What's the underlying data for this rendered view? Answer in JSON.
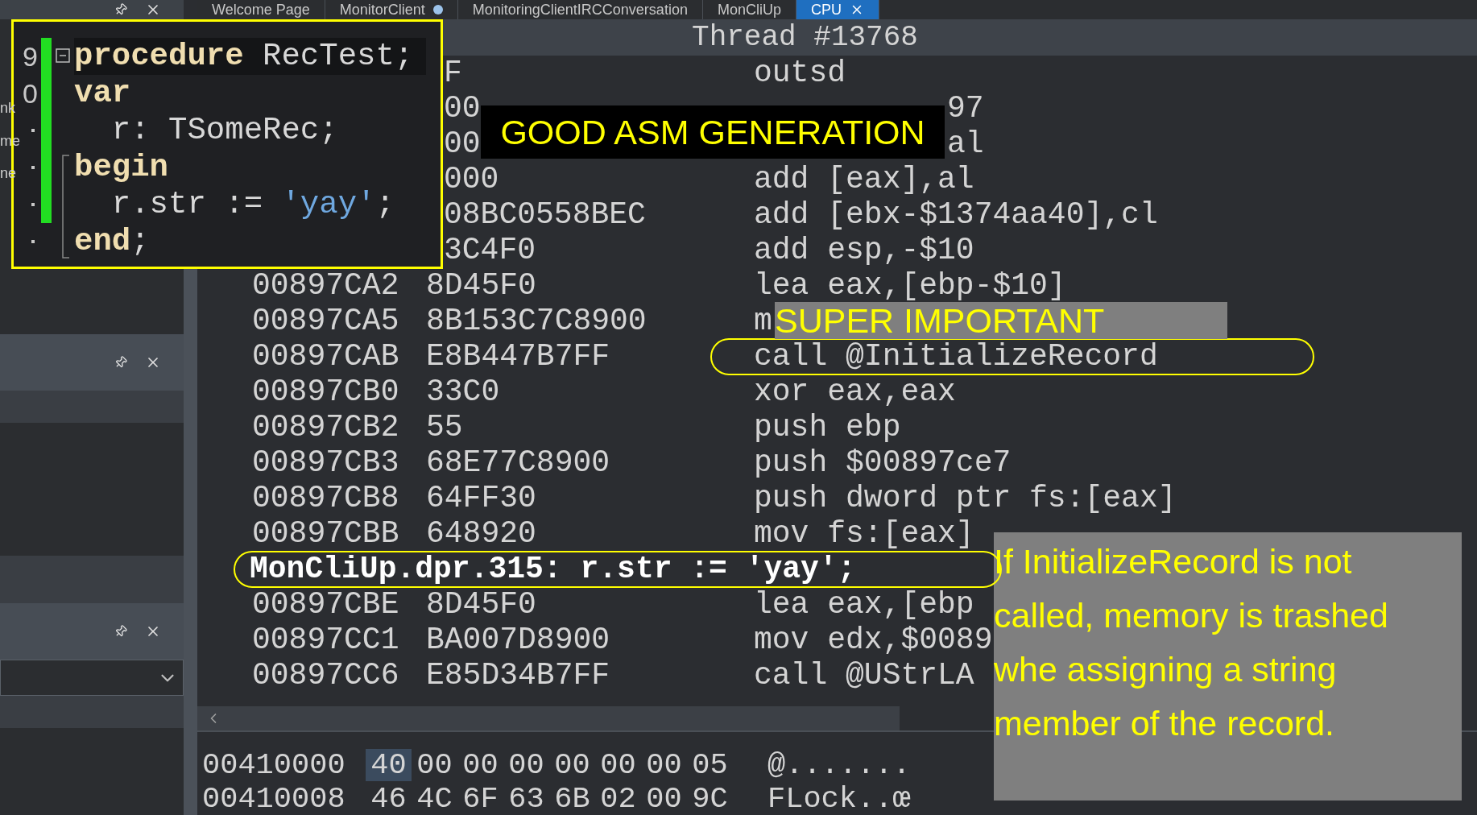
{
  "left_dock": {
    "fragments": [
      "nk",
      "me",
      "ne"
    ]
  },
  "tabs": [
    {
      "label": "Welcome Page",
      "selected": false,
      "modified": false
    },
    {
      "label": "MonitorClient",
      "selected": false,
      "modified": true
    },
    {
      "label": "MonitoringClientIRCConversation",
      "selected": false,
      "modified": false
    },
    {
      "label": "MonCliUp",
      "selected": false,
      "modified": false
    },
    {
      "label": "CPU",
      "selected": true,
      "modified": false
    }
  ],
  "disassembly": {
    "title": "Thread #13768",
    "rows": [
      {
        "kind": "covered",
        "bytes": "F",
        "instruction": "outsd",
        "circled": false
      },
      {
        "kind": "covered-tail",
        "bytes": "00",
        "instruction": "97",
        "circled": false
      },
      {
        "kind": "covered-tail",
        "bytes": "00",
        "instruction": "al",
        "circled": false
      },
      {
        "kind": "covered",
        "bytes": "000",
        "instruction": "add [eax],al",
        "circled": false
      },
      {
        "kind": "covered",
        "bytes": "08BC0558BEC",
        "instruction": "add [ebx-$1374aa40],cl",
        "circled": false
      },
      {
        "kind": "covered",
        "bytes": "3C4F0",
        "instruction": "add esp,-$10",
        "circled": false
      },
      {
        "kind": "line",
        "address": "00897CA2",
        "bytes": "8D45F0",
        "instruction": "lea eax,[ebp-$10]",
        "circled": false
      },
      {
        "kind": "line",
        "address": "00897CA5",
        "bytes": "8B153C7C8900",
        "instruction": "m",
        "circled": false
      },
      {
        "kind": "line",
        "address": "00897CAB",
        "bytes": "E8B447B7FF",
        "instruction": "call @InitializeRecord",
        "circled": true
      },
      {
        "kind": "line",
        "address": "00897CB0",
        "bytes": "33C0",
        "instruction": "xor eax,eax",
        "circled": false
      },
      {
        "kind": "line",
        "address": "00897CB2",
        "bytes": "55",
        "instruction": "push ebp",
        "circled": false
      },
      {
        "kind": "line",
        "address": "00897CB3",
        "bytes": "68E77C8900",
        "instruction": "push $00897ce7",
        "circled": false
      },
      {
        "kind": "line",
        "address": "00897CB8",
        "bytes": "64FF30",
        "instruction": "push dword ptr fs:[eax]",
        "circled": false
      },
      {
        "kind": "line",
        "address": "00897CBB",
        "bytes": "648920",
        "instruction": "mov fs:[eax]",
        "circled": false
      },
      {
        "kind": "source",
        "text": "MonCliUp.dpr.315: r.str := 'yay';",
        "circled": true
      },
      {
        "kind": "line",
        "address": "00897CBE",
        "bytes": "8D45F0",
        "instruction": "lea eax,[ebp",
        "circled": false
      },
      {
        "kind": "line",
        "address": "00897CC1",
        "bytes": "BA007D8900",
        "instruction": "mov edx,$0089",
        "circled": false
      },
      {
        "kind": "line",
        "address": "00897CC6",
        "bytes": "E85D34B7FF",
        "instruction": "call @UStrLA",
        "circled": false
      }
    ]
  },
  "hex_view": {
    "rows": [
      {
        "address": "00410000",
        "bytes": [
          {
            "value": "40",
            "selected": true
          },
          {
            "value": "00",
            "selected": false
          },
          {
            "value": "00",
            "selected": false
          },
          {
            "value": "00",
            "selected": false
          },
          {
            "value": "00",
            "selected": false
          },
          {
            "value": "00",
            "selected": false
          },
          {
            "value": "00",
            "selected": false
          },
          {
            "value": "05",
            "selected": false
          }
        ],
        "ascii": "@......."
      },
      {
        "address": "00410008",
        "bytes": [
          {
            "value": "46",
            "selected": false
          },
          {
            "value": "4C",
            "selected": false
          },
          {
            "value": "6F",
            "selected": false
          },
          {
            "value": "63",
            "selected": false
          },
          {
            "value": "6B",
            "selected": false
          },
          {
            "value": "02",
            "selected": false
          },
          {
            "value": "00",
            "selected": false
          },
          {
            "value": "9C",
            "selected": false
          }
        ],
        "ascii": "FLock..œ"
      }
    ]
  },
  "code_snippet": {
    "line_numbers": [
      "9",
      "0"
    ],
    "lines": [
      {
        "current": true,
        "tokens": [
          {
            "kind": "keyword",
            "text": "procedure"
          },
          {
            "kind": "plain",
            "text": " RecTest;"
          }
        ]
      },
      {
        "current": false,
        "tokens": [
          {
            "kind": "keyword",
            "text": "var"
          }
        ]
      },
      {
        "current": false,
        "tokens": [
          {
            "kind": "plain",
            "text": "  r: TSomeRec;"
          }
        ]
      },
      {
        "current": false,
        "tokens": [
          {
            "kind": "keyword",
            "text": "begin"
          }
        ]
      },
      {
        "current": false,
        "tokens": [
          {
            "kind": "plain",
            "text": "  r.str := "
          },
          {
            "kind": "string",
            "text": "'yay'"
          },
          {
            "kind": "plain",
            "text": ";"
          }
        ]
      },
      {
        "current": false,
        "tokens": [
          {
            "kind": "keyword",
            "text": "end"
          },
          {
            "kind": "plain",
            "text": ";"
          }
        ]
      }
    ]
  },
  "annotations": [
    {
      "kind": "title-label",
      "text": "GOOD ASM GENERATION"
    },
    {
      "kind": "highlight-label",
      "text": "SUPER IMPORTANT"
    },
    {
      "kind": "note",
      "text": "If InitializeRecord is not called, memory is trashed whe assigning a string member of the record."
    }
  ]
}
